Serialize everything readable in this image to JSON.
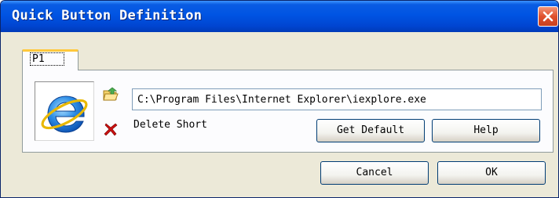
{
  "window": {
    "title": "Quick Button Definition"
  },
  "tabs": [
    {
      "label": "P1",
      "active": true
    }
  ],
  "shortcut": {
    "icon": "internet-explorer-icon",
    "path_value": "C:\\Program Files\\Internet Explorer\\iexplore.exe",
    "browse_icon": "folder-open-icon",
    "delete_icon": "red-x-icon",
    "delete_label": "Delete Short"
  },
  "buttons": {
    "get_default": "Get Default",
    "help": "Help",
    "cancel": "Cancel",
    "ok": "OK"
  },
  "colors": {
    "titlebar": "#0054e3",
    "dialog_bg": "#ece9d8",
    "close_button": "#e0512e",
    "tab_highlight": "#ffc83c",
    "delete_red": "#cc1111"
  }
}
